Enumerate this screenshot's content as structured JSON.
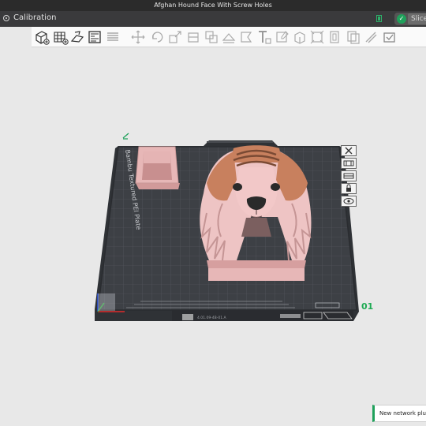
{
  "window": {
    "title": "Afghan Hound Face With Screw Holes"
  },
  "tabbar": {
    "tab_label": "Calibration",
    "slice_label": "Slice",
    "slice_check": "✓"
  },
  "toolbar": {
    "icons": [
      "add-object-icon",
      "arrange-grid-icon",
      "auto-orient-icon",
      "plate-settings-icon",
      "layer-list-icon",
      "move-icon",
      "rotate-icon",
      "scale-icon",
      "cut-icon",
      "split-objects-icon",
      "split-parts-icon",
      "place-on-face-icon",
      "text-icon",
      "support-paint-icon",
      "seam-paint-icon",
      "measure-icon",
      "assembly-icon",
      "boolean-icon",
      "variable-layer-icon",
      "brim-ears-icon"
    ]
  },
  "plate": {
    "name_label": "Bambu Textured PEI Plate",
    "plate_number": "01",
    "bottom_text": "4.01.09-4B-01.A"
  },
  "colors": {
    "bed": "#3d4045",
    "grid": "#5d6168",
    "model_pink": "#ecc0c0",
    "model_brown": "#c8805e",
    "accent_green": "#1fa15b"
  },
  "notification": {
    "text": "New network plug-in available"
  }
}
